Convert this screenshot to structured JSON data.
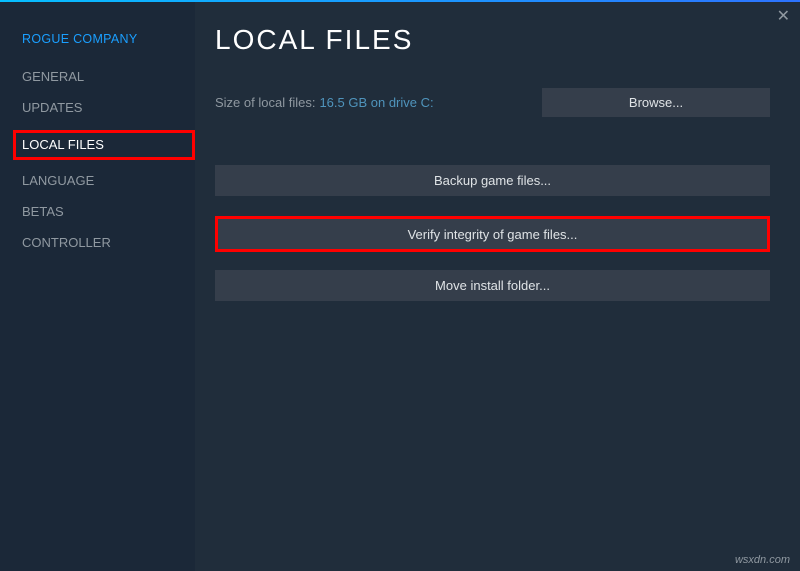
{
  "sidebar": {
    "title": "ROGUE COMPANY",
    "items": [
      {
        "label": "GENERAL"
      },
      {
        "label": "UPDATES"
      },
      {
        "label": "LOCAL FILES"
      },
      {
        "label": "LANGUAGE"
      },
      {
        "label": "BETAS"
      },
      {
        "label": "CONTROLLER"
      }
    ]
  },
  "main": {
    "title": "LOCAL FILES",
    "size_label": "Size of local files:",
    "size_value": "16.5 GB on drive C:",
    "browse_label": "Browse...",
    "backup_label": "Backup game files...",
    "verify_label": "Verify integrity of game files...",
    "move_label": "Move install folder..."
  },
  "watermark": "wsxdn.com"
}
